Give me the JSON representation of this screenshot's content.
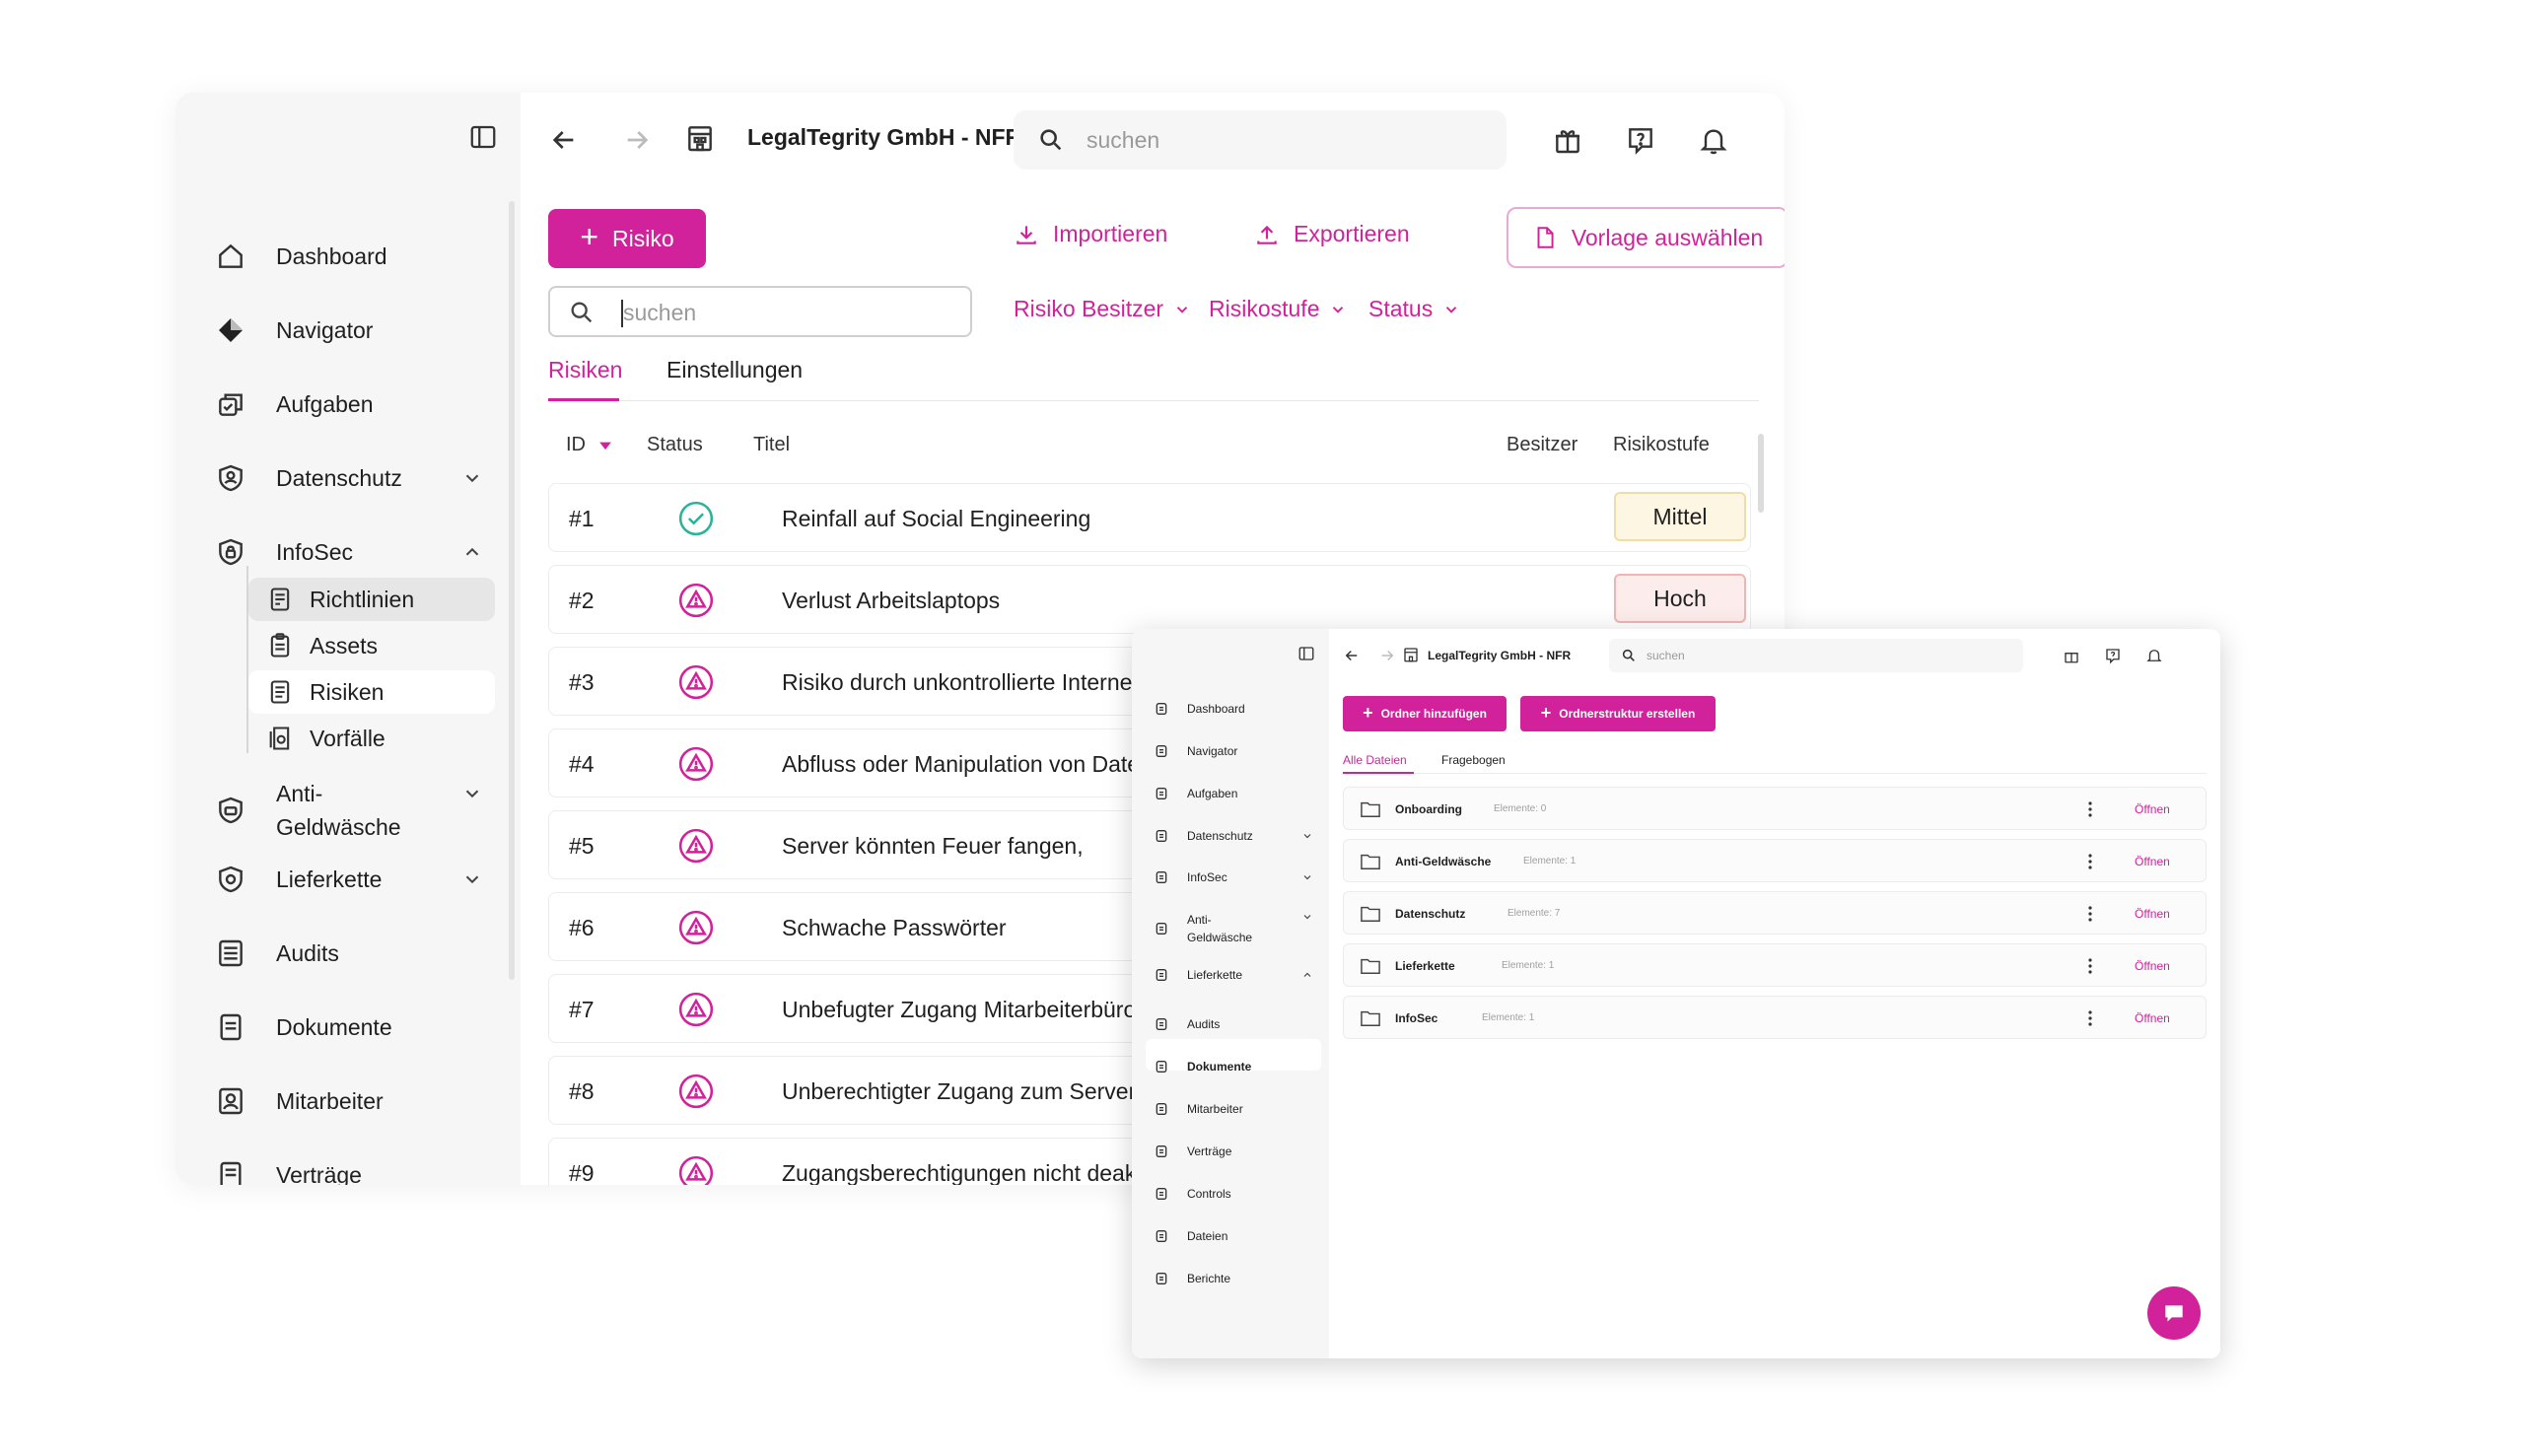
{
  "colors": {
    "accent": "#d1229b",
    "sidebar_bg": "#f6f6f6"
  },
  "win1": {
    "sidebar": {
      "items": [
        {
          "label": "Dashboard",
          "icon": "home-icon"
        },
        {
          "label": "Navigator",
          "icon": "navigator-icon"
        },
        {
          "label": "Aufgaben",
          "icon": "tasks-icon"
        },
        {
          "label": "Datenschutz",
          "icon": "shield-user-icon"
        },
        {
          "label": "InfoSec",
          "icon": "shield-lock-icon"
        },
        {
          "label": "Anti-\nGeldwäsche",
          "icon": "shield-money-icon"
        },
        {
          "label": "Lieferkette",
          "icon": "shield-chain-icon"
        },
        {
          "label": "Audits",
          "icon": "audit-icon"
        },
        {
          "label": "Dokumente",
          "icon": "document-icon"
        },
        {
          "label": "Mitarbeiter",
          "icon": "employee-icon"
        },
        {
          "label": "Verträge",
          "icon": "contract-icon"
        }
      ],
      "infosec_sub": [
        {
          "label": "Richtlinien"
        },
        {
          "label": "Assets"
        },
        {
          "label": "Risiken"
        },
        {
          "label": "Vorfälle"
        }
      ]
    },
    "topbar": {
      "company": "LegalTegrity GmbH - NFR",
      "search_placeholder": "suchen"
    },
    "toolbar": {
      "add_risk": "Risiko",
      "import": "Importieren",
      "export": "Exportieren",
      "template": "Vorlage auswählen"
    },
    "filters": {
      "search_placeholder": "suchen",
      "owner": "Risiko Besitzer",
      "level": "Risikostufe",
      "status": "Status"
    },
    "tabs": [
      "Risiken",
      "Einstellungen"
    ],
    "table": {
      "headers": {
        "id": "ID",
        "status": "Status",
        "title": "Titel",
        "owner": "Besitzer",
        "level": "Risikostufe"
      },
      "rows": [
        {
          "id": "#1",
          "status": "done",
          "title": "Reinfall auf Social Engineering",
          "level": "Mittel"
        },
        {
          "id": "#2",
          "status": "warning",
          "title": "Verlust Arbeitslaptops",
          "level": "Hoch"
        },
        {
          "id": "#3",
          "status": "warning",
          "title": "Risiko durch unkontrollierte Interne",
          "level": ""
        },
        {
          "id": "#4",
          "status": "warning",
          "title": "Abfluss oder Manipulation von Date",
          "level": ""
        },
        {
          "id": "#5",
          "status": "warning",
          "title": "Server könnten Feuer fangen,",
          "level": ""
        },
        {
          "id": "#6",
          "status": "warning",
          "title": "Schwache Passwörter",
          "level": ""
        },
        {
          "id": "#7",
          "status": "warning",
          "title": "Unbefugter Zugang Mitarbeiterbüro",
          "level": ""
        },
        {
          "id": "#8",
          "status": "warning",
          "title": "Unberechtigter Zugang zum Server",
          "level": ""
        },
        {
          "id": "#9",
          "status": "warning",
          "title": "Zugangsberechtigungen nicht deak",
          "level": ""
        }
      ]
    }
  },
  "win2": {
    "sidebar": {
      "items": [
        {
          "label": "Dashboard"
        },
        {
          "label": "Navigator"
        },
        {
          "label": "Aufgaben"
        },
        {
          "label": "Datenschutz"
        },
        {
          "label": "InfoSec"
        },
        {
          "label": "Anti-\nGeldwäsche"
        },
        {
          "label": "Lieferkette"
        },
        {
          "label": "Audits"
        },
        {
          "label": "Dokumente"
        },
        {
          "label": "Mitarbeiter"
        },
        {
          "label": "Verträge"
        },
        {
          "label": "Controls"
        },
        {
          "label": "Dateien"
        },
        {
          "label": "Berichte"
        }
      ]
    },
    "topbar": {
      "company": "LegalTegrity GmbH - NFR",
      "search_placeholder": "suchen"
    },
    "buttons": {
      "add_folder": "Ordner hinzufügen",
      "create_structure": "Ordnerstruktur erstellen"
    },
    "tabs": [
      "Alle Dateien",
      "Fragebogen"
    ],
    "folders": [
      {
        "name": "Onboarding",
        "count": "Elemente: 0",
        "action": "Öffnen"
      },
      {
        "name": "Anti-Geldwäsche",
        "count": "Elemente: 1",
        "action": "Öffnen"
      },
      {
        "name": "Datenschutz",
        "count": "Elemente: 7",
        "action": "Öffnen"
      },
      {
        "name": "Lieferkette",
        "count": "Elemente: 1",
        "action": "Öffnen"
      },
      {
        "name": "InfoSec",
        "count": "Elemente: 1",
        "action": "Öffnen"
      }
    ]
  }
}
